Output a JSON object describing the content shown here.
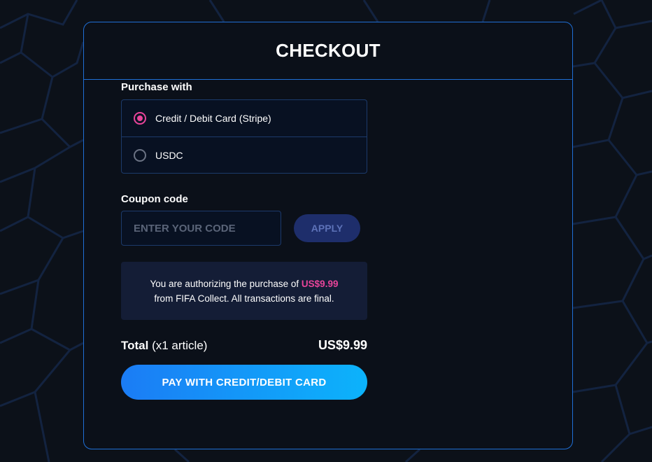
{
  "checkout": {
    "title": "CHECKOUT",
    "purchase_label": "Purchase with",
    "payment_options": [
      {
        "label": "Credit / Debit Card (Stripe)",
        "selected": true
      },
      {
        "label": "USDC",
        "selected": false
      }
    ],
    "coupon": {
      "label": "Coupon code",
      "placeholder": "ENTER YOUR CODE",
      "value": "",
      "apply_label": "APPLY"
    },
    "notice": {
      "prefix": "You are authorizing the purchase of ",
      "price": "US$9.99",
      "line2": "from FIFA Collect. All transactions are final."
    },
    "total": {
      "label": "Total",
      "detail": " (x1 article)",
      "amount": "US$9.99"
    },
    "pay_button_label": "PAY WITH CREDIT/DEBIT CARD"
  },
  "colors": {
    "accent_pink": "#e8449a",
    "border_blue": "#1f6fd6",
    "button_gradient_start": "#1b7cf5",
    "button_gradient_end": "#0cb3fb",
    "background": "#0c1119"
  },
  "icons": [
    "radio-checked-icon",
    "radio-unchecked-icon"
  ]
}
